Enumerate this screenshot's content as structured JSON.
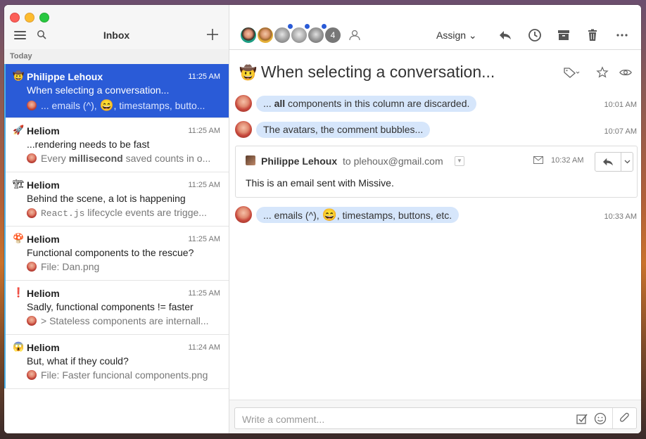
{
  "sidebar": {
    "title": "Inbox",
    "section_label": "Today",
    "items": [
      {
        "emoji": "🤠",
        "from": "Philippe Lehoux",
        "time": "11:25 AM",
        "subject": "When selecting a conversation...",
        "preview_a": "... emails (^),",
        "preview_emoji": "😄",
        "preview_b": ", timestamps, butto...",
        "selected": true
      },
      {
        "emoji": "🚀",
        "from": "Heliom",
        "time": "11:25 AM",
        "subject": "...rendering needs to be fast",
        "preview_a": "Every ",
        "preview_bold": "millisecond",
        "preview_b": " saved counts in o..."
      },
      {
        "emoji": "🏗",
        "from": "Heliom",
        "time": "11:25 AM",
        "subject": "Behind the scene, a lot is happening",
        "preview_code": "React.js",
        "preview_b": " lifecycle events are trigge..."
      },
      {
        "emoji": "🍄",
        "from": "Heliom",
        "time": "11:25 AM",
        "subject": "Functional components to the rescue?",
        "preview": "File: Dan.png"
      },
      {
        "emoji": "❗",
        "from": "Heliom",
        "time": "11:25 AM",
        "subject": "Sadly, functional components != faster",
        "preview": "> Stateless components are internall..."
      },
      {
        "emoji": "😱",
        "from": "Heliom",
        "time": "11:24 AM",
        "subject": "But, what if they could?",
        "preview": "File: Faster funcional components.png"
      }
    ]
  },
  "toolbar": {
    "participant_overflow": "4",
    "assign_label": "Assign ⌄"
  },
  "conversation": {
    "emoji": "🤠",
    "title": "When selecting a conversation...",
    "messages": [
      {
        "text_a": "... ",
        "text_bold": "all",
        "text_b": " components in this column are discarded.",
        "time": "10:01 AM"
      },
      {
        "text": "The avatars, the comment bubbles...",
        "time": "10:07 AM"
      },
      {
        "text_a": "... emails (^), ",
        "emoji": "😄",
        "text_b": ", timestamps, buttons, etc.",
        "time": "10:33 AM"
      }
    ],
    "email": {
      "sender": "Philippe Lehoux",
      "to": "to plehoux@gmail.com",
      "time": "10:32 AM",
      "body": "This is an email sent with Missive."
    }
  },
  "composer": {
    "placeholder": "Write a comment..."
  },
  "colors": {
    "selected": "#2a5bd7",
    "bubble": "#d6e6fb",
    "accent": "#4bb0e8"
  }
}
